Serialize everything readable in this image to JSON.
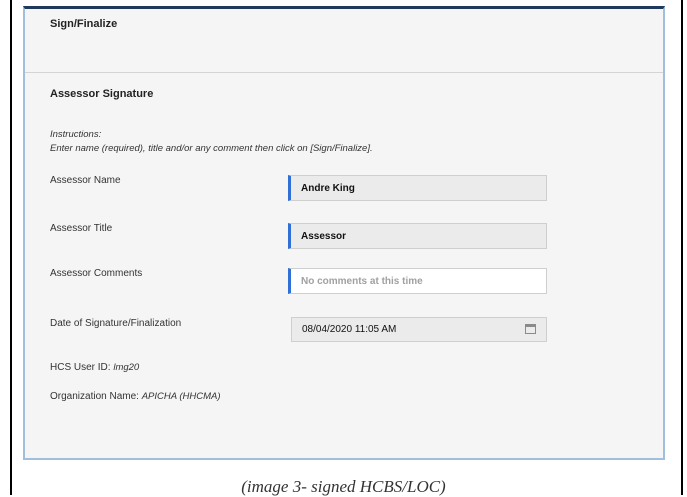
{
  "header": {
    "title": "Sign/Finalize"
  },
  "section": {
    "title": "Assessor Signature",
    "instructions_label": "Instructions:",
    "instructions_text": "Enter name (required), title and/or any comment then click on [Sign/Finalize]."
  },
  "fields": {
    "assessor_name": {
      "label": "Assessor Name",
      "value": "Andre King"
    },
    "assessor_title": {
      "label": "Assessor Title",
      "value": "Assessor"
    },
    "assessor_comments": {
      "label": "Assessor Comments",
      "placeholder": "No comments at this time"
    },
    "signature_date": {
      "label": "Date of Signature/Finalization",
      "value": "08/04/2020 11:05 AM",
      "icon": "calendar-icon"
    }
  },
  "info": {
    "hcs_user_id_label": "HCS User ID:",
    "hcs_user_id_value": "lmg20",
    "organization_label": "Organization Name:",
    "organization_value": "APICHA (HHCMA)"
  },
  "caption": "(image 3- signed HCBS/LOC)",
  "colors": {
    "accent": "#2f6fd6",
    "panel_border": "#9fbfdc",
    "panel_top": "#1f3a5c"
  }
}
